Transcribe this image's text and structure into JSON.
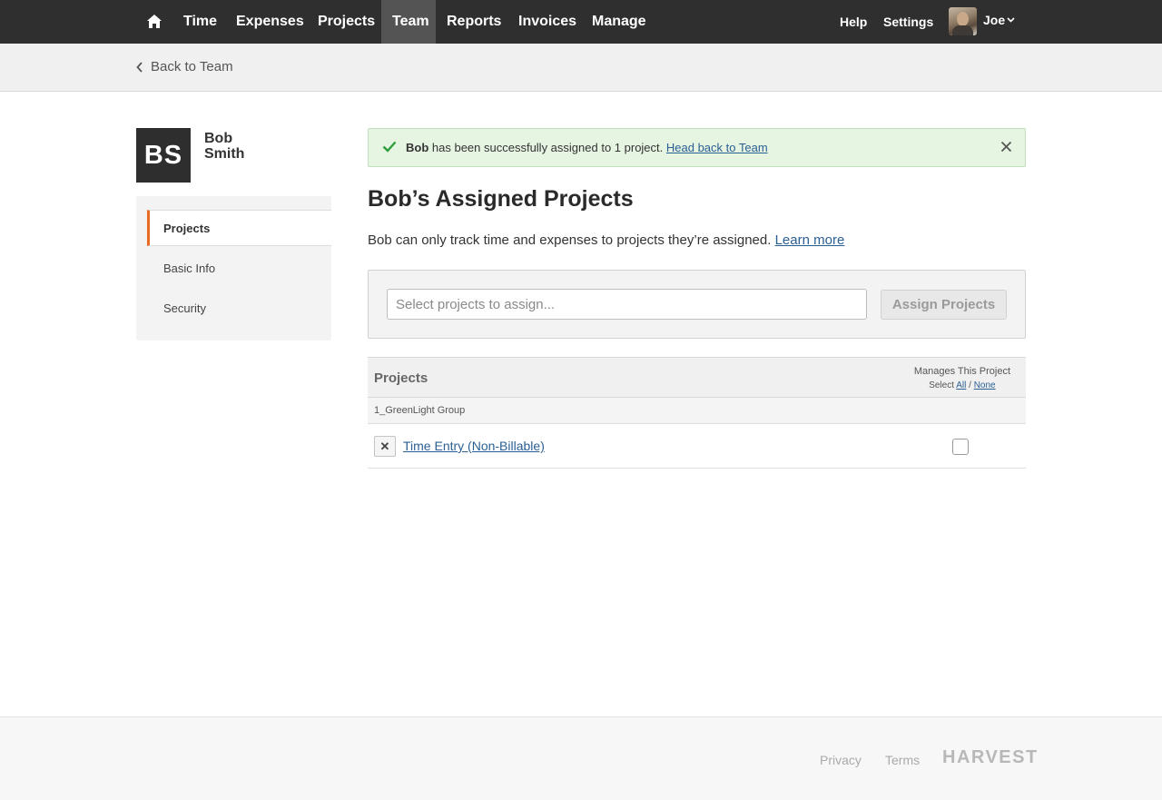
{
  "nav": {
    "items": [
      {
        "label": "Time"
      },
      {
        "label": "Expenses"
      },
      {
        "label": "Projects"
      },
      {
        "label": "Team"
      },
      {
        "label": "Reports"
      },
      {
        "label": "Invoices"
      },
      {
        "label": "Manage"
      }
    ],
    "active": "Team",
    "help": "Help",
    "settings": "Settings",
    "user_name": "Joe"
  },
  "subheader": {
    "back_label": "Back to Team"
  },
  "person": {
    "initials": "BS",
    "first_name": "Bob",
    "last_name": "Smith"
  },
  "sidenav": {
    "items": [
      {
        "label": "Projects"
      },
      {
        "label": "Basic Info"
      },
      {
        "label": "Security"
      }
    ],
    "active": "Projects"
  },
  "flash": {
    "name": "Bob",
    "message": " has been successfully assigned to 1 project. ",
    "link": "Head back to Team"
  },
  "page": {
    "title": "Bob’s Assigned Projects",
    "intro": "Bob can only track time and expenses to projects they’re assigned. ",
    "learn_more": "Learn more"
  },
  "assign": {
    "placeholder": "Select projects to assign...",
    "button": "Assign Projects"
  },
  "table": {
    "header": "Projects",
    "manages_header": "Manages This Project",
    "select_label": "Select",
    "select_all": "All",
    "select_sep": " / ",
    "select_none": "None",
    "groups": [
      {
        "client": "1_GreenLight Group",
        "projects": [
          {
            "name": "Time Entry (Non-Billable)",
            "manages": false
          }
        ]
      }
    ]
  },
  "footer": {
    "privacy": "Privacy",
    "terms": "Terms",
    "logo": "HARVEST"
  },
  "colors": {
    "nav_bg": "#2f2f2f",
    "nav_active": "#545454",
    "accent": "#e86a1f",
    "link": "#2a5f94",
    "success_bg": "#e6f4e2"
  }
}
